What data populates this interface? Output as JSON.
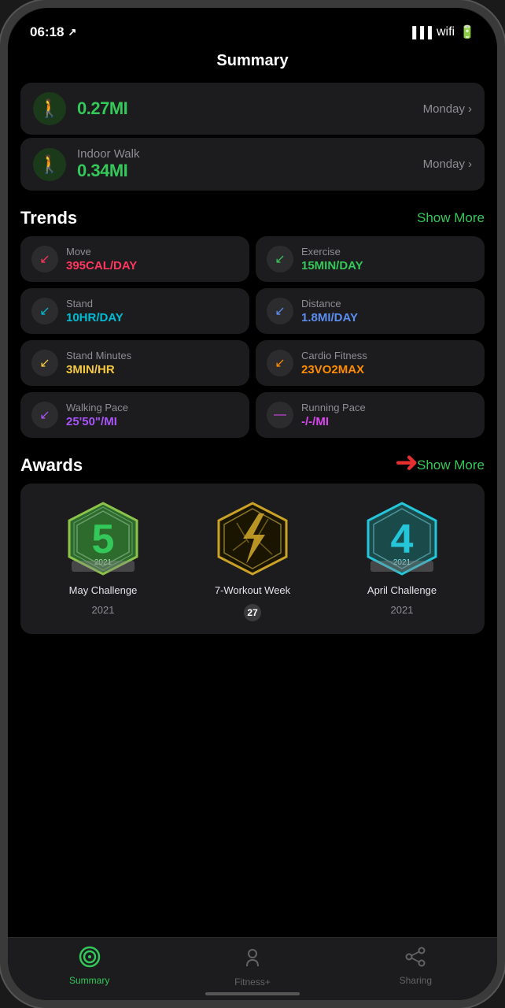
{
  "statusBar": {
    "time": "06:18",
    "locationIcon": "↗"
  },
  "header": {
    "title": "Summary"
  },
  "activityCards": [
    {
      "icon": "🚶",
      "iconBg": "#1a3a1a",
      "value": "0.27MI",
      "valueColor": "#34c759",
      "dayLabel": "Monday",
      "hasLabel": false
    },
    {
      "icon": "🚶",
      "iconBg": "#1a3a1a",
      "label": "Indoor Walk",
      "value": "0.34MI",
      "valueColor": "#34c759",
      "dayLabel": "Monday",
      "hasLabel": true
    }
  ],
  "trends": {
    "title": "Trends",
    "showMore": "Show More",
    "items": [
      {
        "label": "Move",
        "value": "395CAL/DAY",
        "valueColor": "#ff375f",
        "arrowColor": "#ff375f",
        "arrowDir": "↙"
      },
      {
        "label": "Exercise",
        "value": "15MIN/DAY",
        "valueColor": "#34c759",
        "arrowColor": "#34c759",
        "arrowDir": "↙"
      },
      {
        "label": "Stand",
        "value": "10HR/DAY",
        "valueColor": "#00bcd4",
        "arrowColor": "#00bcd4",
        "arrowDir": "↙"
      },
      {
        "label": "Distance",
        "value": "1.8MI/DAY",
        "valueColor": "#5b8ef0",
        "arrowColor": "#5b8ef0",
        "arrowDir": "↙"
      },
      {
        "label": "Stand Minutes",
        "value": "3MIN/HR",
        "valueColor": "#f5c842",
        "arrowColor": "#f5c842",
        "arrowDir": "↙"
      },
      {
        "label": "Cardio Fitness",
        "value": "23VO2MAX",
        "valueColor": "#ff8c00",
        "arrowColor": "#ff8c00",
        "arrowDir": "↙"
      },
      {
        "label": "Walking Pace",
        "value": "25'50\"/MI",
        "valueColor": "#a855f7",
        "arrowColor": "#a855f7",
        "arrowDir": "↙"
      },
      {
        "label": "Running Pace",
        "value": "-/-/MI",
        "valueColor": "#d946ef",
        "arrowColor": "#d946ef",
        "arrowDir": "—"
      }
    ]
  },
  "awards": {
    "title": "Awards",
    "showMore": "Show More",
    "items": [
      {
        "name": "May Challenge",
        "year": "2021",
        "badgeType": "may"
      },
      {
        "name": "7-Workout Week",
        "year": "",
        "badgeNumber": "27",
        "badgeType": "workout"
      },
      {
        "name": "April Challenge",
        "year": "2021",
        "badgeType": "april"
      }
    ]
  },
  "tabBar": {
    "items": [
      {
        "label": "Summary",
        "icon": "⊙",
        "active": true
      },
      {
        "label": "Fitness+",
        "icon": "🏃",
        "active": false
      },
      {
        "label": "Sharing",
        "icon": "𝕊",
        "active": false
      }
    ]
  }
}
